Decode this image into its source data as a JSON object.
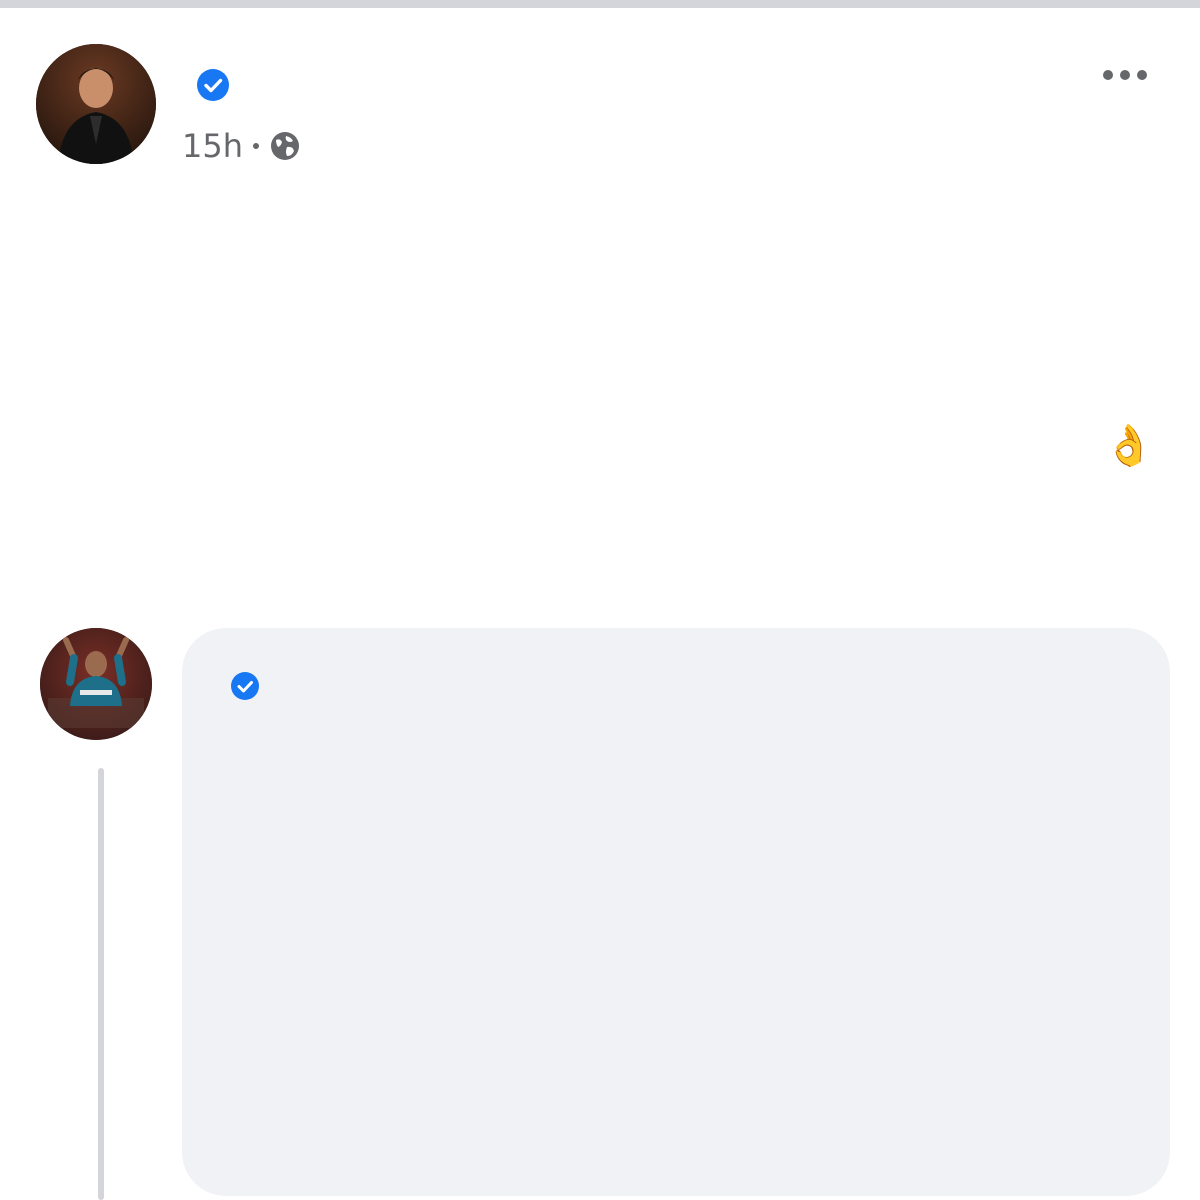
{
  "post": {
    "author": "",
    "timestamp": "15h",
    "privacy_icon": "globe-icon",
    "more_icon": "more-horizontal-icon",
    "verified_icon": "verified-badge-icon",
    "body": {
      "line1": "",
      "line2": "",
      "line3": "",
      "line4": "",
      "emoji": "👌"
    }
  },
  "comment": {
    "author": "",
    "verified_icon": "verified-badge-icon",
    "lines": [
      "",
      "",
      "",
      "",
      "",
      "",
      ""
    ]
  },
  "colors": {
    "verified": "#1877f2",
    "bubble": "#f0f2f5",
    "meta": "#65676b"
  }
}
